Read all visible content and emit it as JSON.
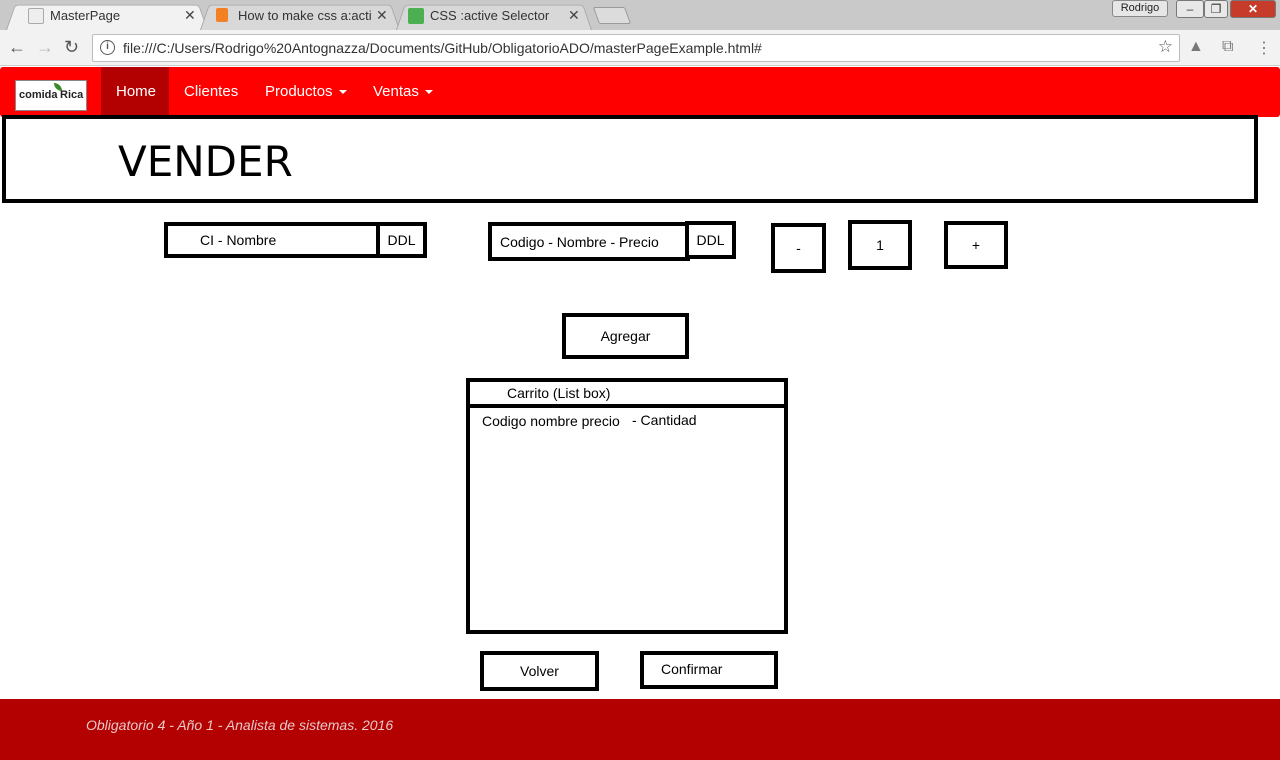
{
  "browser": {
    "tabs": [
      {
        "title": "MasterPage",
        "favicon": "page-icon",
        "active": true
      },
      {
        "title": "How to make css a:active",
        "favicon": "stackoverflow-icon",
        "active": false
      },
      {
        "title": "CSS :active Selector",
        "favicon": "w3schools-icon",
        "active": false
      }
    ],
    "user": "Rodrigo",
    "url": "file:///C:/Users/Rodrigo%20Antognazza/Documents/GitHub/ObligatorioADO/masterPageExample.html#"
  },
  "navbar": {
    "brand_left": "comida",
    "brand_right": "Rica",
    "items": [
      {
        "label": "Home",
        "active": true
      },
      {
        "label": "Clientes"
      },
      {
        "label": "Productos"
      },
      {
        "label": "Ventas"
      }
    ]
  },
  "page": {
    "title": "VENDER",
    "client_select": {
      "label": "CI - Nombre",
      "ddl": "DDL"
    },
    "product_select": {
      "label": "Codigo - Nombre - Precio",
      "ddl": "DDL"
    },
    "quantity": {
      "minus": "-",
      "value": "1",
      "plus": "+"
    },
    "add_button": "Agregar",
    "cart": {
      "header": "Carrito (List box)",
      "columns": "Codigo nombre precio",
      "quantity_col": "- Cantidad"
    },
    "back_button": "Volver",
    "confirm_button": "Confirmar"
  },
  "footer": {
    "text": "Obligatorio 4 - Año 1 - Analista de sistemas. 2016"
  },
  "colors": {
    "navbar": "#ff0000",
    "navbar_active": "#b30000",
    "footer": "#b30000"
  }
}
